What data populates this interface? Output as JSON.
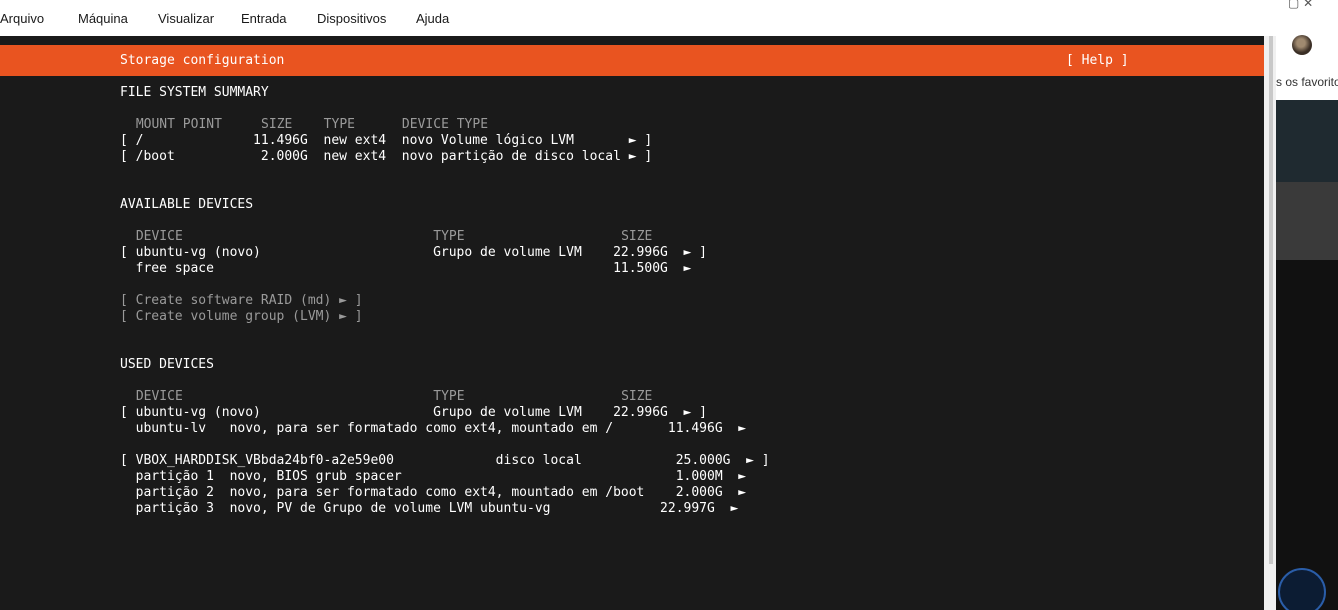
{
  "menubar": {
    "items": [
      "Arquivo",
      "Máquina",
      "Visualizar",
      "Entrada",
      "Dispositivos",
      "Ajuda"
    ]
  },
  "installer": {
    "title": "Storage configuration",
    "help": "[ Help ]",
    "fs_summary": {
      "heading": "FILE SYSTEM SUMMARY",
      "header": " MOUNT POINT     SIZE    TYPE      DEVICE TYPE",
      "rows": [
        "[ /              11.496G  new ext4  novo Volume lógico LVM       ► ]",
        "[ /boot           2.000G  new ext4  novo partição de disco local ► ]"
      ]
    },
    "available": {
      "heading": "AVAILABLE DEVICES",
      "header": " DEVICE                                TYPE                    SIZE",
      "rows": [
        "[ ubuntu-vg (novo)                      Grupo de volume LVM    22.996G  ► ]",
        "  free space                                                   11.500G  ►"
      ],
      "actions": [
        "[ Create software RAID (md) ► ]",
        "[ Create volume group (LVM) ► ]"
      ]
    },
    "used": {
      "heading": "USED DEVICES",
      "header": " DEVICE                                TYPE                    SIZE",
      "rows": [
        "[ ubuntu-vg (novo)                      Grupo de volume LVM    22.996G  ► ]",
        "  ubuntu-lv   novo, para ser formatado como ext4, mountado em /       11.496G  ►",
        "[ VBOX_HARDDISK_VBbda24bf0-a2e59e00             disco local            25.000G  ► ]",
        "  partição 1  novo, BIOS grub spacer                                   1.000M  ►",
        "  partição 2  novo, para ser formatado como ext4, mountado em /boot    2.000G  ►",
        "  partição 3  novo, PV de Grupo de volume LVM ubuntu-vg              22.997G  ►"
      ]
    }
  },
  "browser": {
    "bookmarks_text": "s os favorito",
    "window_icons": "▢  ✕",
    "kebab": "⋮"
  }
}
